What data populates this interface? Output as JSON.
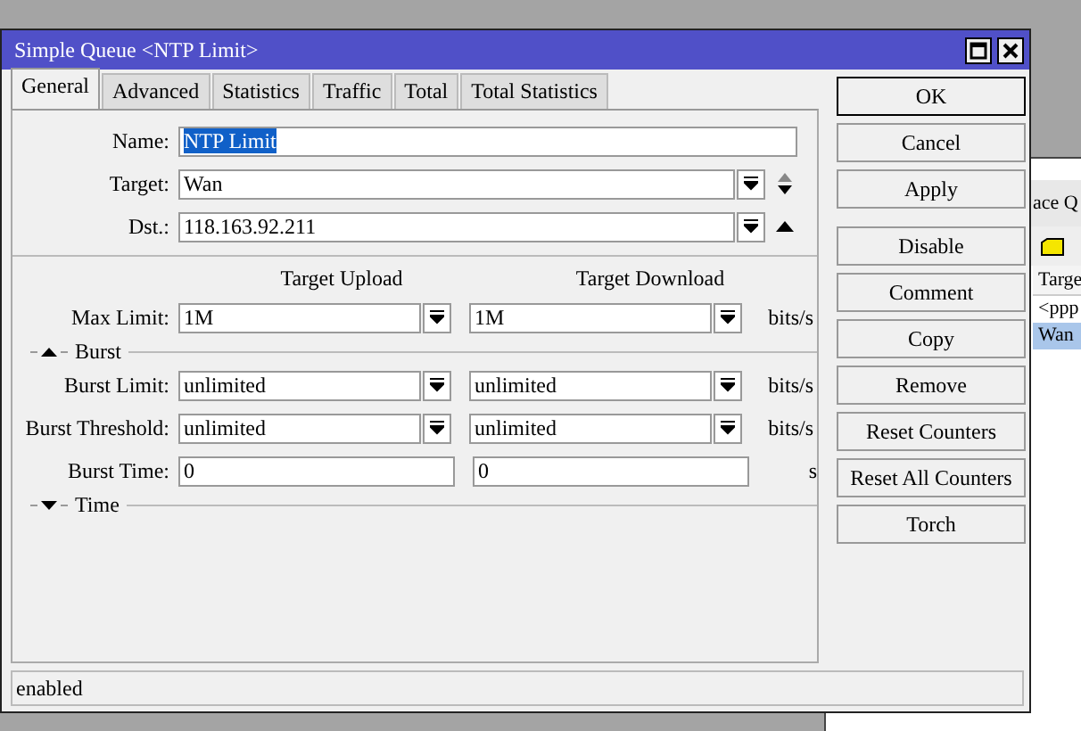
{
  "background_window": {
    "title": "ace Q",
    "column": "Targe",
    "rows": [
      {
        "text": "<ppp",
        "selected": false
      },
      {
        "text": "Wan",
        "selected": true
      }
    ]
  },
  "window": {
    "title": "Simple Queue <NTP Limit>"
  },
  "tabs": [
    {
      "label": "General",
      "selected": true
    },
    {
      "label": "Advanced",
      "selected": false
    },
    {
      "label": "Statistics",
      "selected": false
    },
    {
      "label": "Traffic",
      "selected": false
    },
    {
      "label": "Total",
      "selected": false
    },
    {
      "label": "Total Statistics",
      "selected": false
    }
  ],
  "fields": [
    {
      "label": "Name:",
      "value": "NTP Limit",
      "kind": "text",
      "selected": true
    },
    {
      "label": "Target:",
      "value": "Wan",
      "kind": "dropdown",
      "stepper": {
        "kind": "updown"
      },
      "selected": false
    },
    {
      "label": "Dst.:",
      "value": "118.163.92.211",
      "kind": "dropdown",
      "stepper": {
        "kind": "up"
      },
      "selected": false
    }
  ],
  "columns": [
    "Target Upload",
    "Target Download"
  ],
  "limits": [
    {
      "label": "Max Limit:",
      "upload": "1M",
      "download": "1M",
      "kind": "dropdown",
      "unit": "bits/s"
    }
  ],
  "sections": [
    {
      "title": "Burst",
      "expanded": true,
      "rows": [
        {
          "label": "Burst Limit:",
          "upload": "unlimited",
          "download": "unlimited",
          "kind": "dropdown",
          "unit": "bits/s"
        },
        {
          "label": "Burst Threshold:",
          "upload": "unlimited",
          "download": "unlimited",
          "kind": "dropdown",
          "unit": "bits/s"
        },
        {
          "label": "Burst Time:",
          "upload": "0",
          "download": "0",
          "kind": "text",
          "unit": "s"
        }
      ]
    },
    {
      "title": "Time",
      "expanded": false
    }
  ],
  "button_groups": [
    [
      {
        "label": "OK",
        "default": true
      },
      {
        "label": "Cancel",
        "default": false
      },
      {
        "label": "Apply",
        "default": false
      }
    ],
    [
      {
        "label": "Disable",
        "default": false
      },
      {
        "label": "Comment",
        "default": false
      },
      {
        "label": "Copy",
        "default": false
      },
      {
        "label": "Remove",
        "default": false
      },
      {
        "label": "Reset Counters",
        "default": false
      },
      {
        "label": "Reset All Counters",
        "default": false
      },
      {
        "label": "Torch",
        "default": false
      }
    ]
  ],
  "status_bar": "enabled"
}
